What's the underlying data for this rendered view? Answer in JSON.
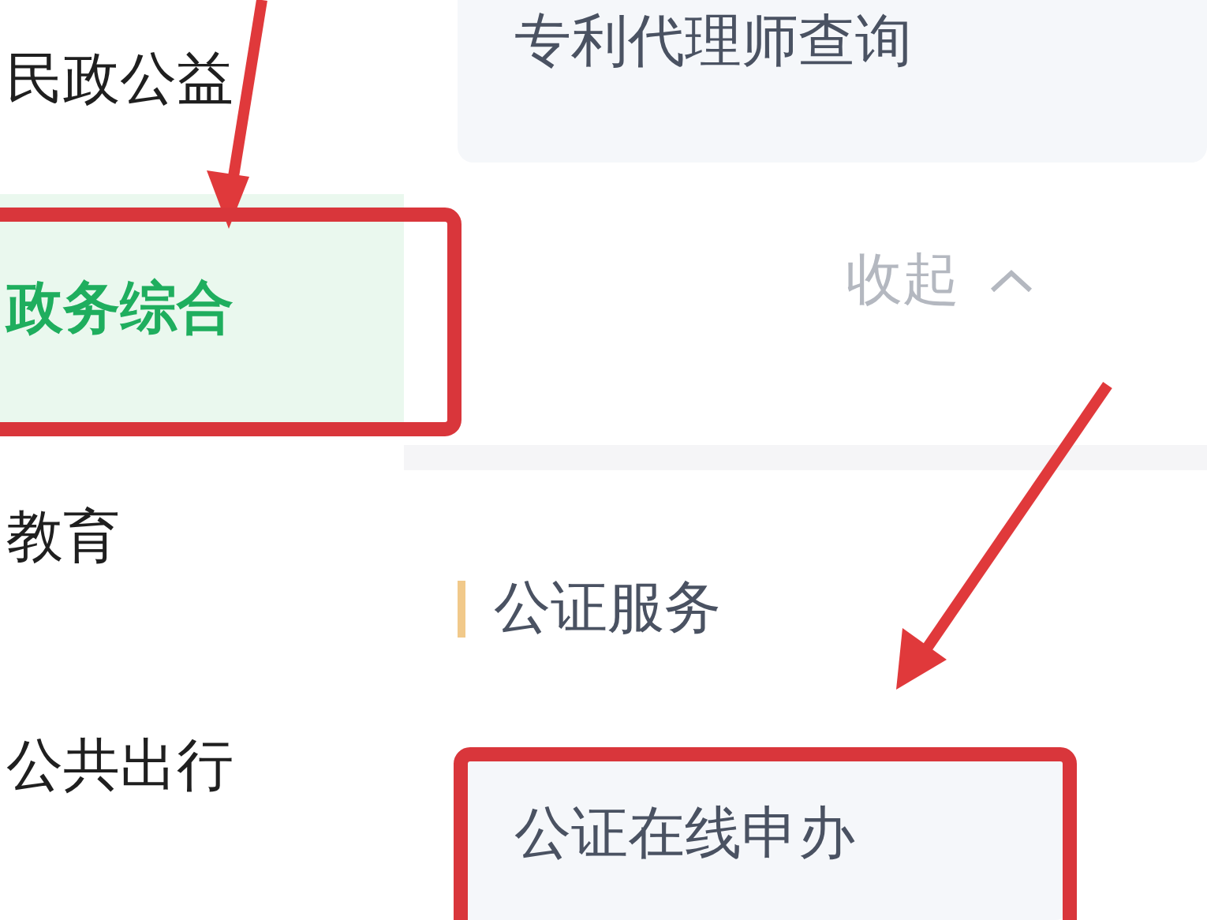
{
  "sidebar": {
    "items": [
      {
        "label": "民政公益",
        "selected": false
      },
      {
        "label": "政务综合",
        "selected": true
      },
      {
        "label": "教育",
        "selected": false
      },
      {
        "label": "公共出行",
        "selected": false
      }
    ]
  },
  "top_card": {
    "title": "专利代理师查询"
  },
  "collapse_toggle": {
    "label": "收起"
  },
  "section": {
    "title": "公证服务",
    "items": [
      {
        "title": "公证在线申办"
      }
    ]
  }
}
